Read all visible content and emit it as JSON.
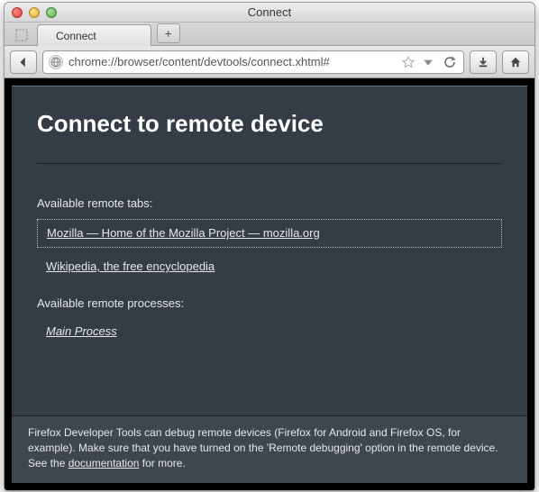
{
  "window": {
    "title": "Connect"
  },
  "tab": {
    "label": "Connect",
    "newtab_glyph": "+"
  },
  "url": "chrome://browser/content/devtools/connect.xhtml#",
  "page": {
    "heading": "Connect to remote device",
    "tabs_label": "Available remote tabs:",
    "remote_tabs": [
      {
        "label": "Mozilla — Home of the Mozilla Project — mozilla.org",
        "selected": true
      },
      {
        "label": "Wikipedia, the free encyclopedia",
        "selected": false
      }
    ],
    "processes_label": "Available remote processes:",
    "processes": [
      {
        "label": "Main Process"
      }
    ],
    "footer_pre": "Firefox Developer Tools can debug remote devices (Firefox for Android and Firefox OS, for example). Make sure that you have turned on the 'Remote debugging' option in the remote device. See the ",
    "footer_link": "documentation",
    "footer_post": " for more."
  }
}
